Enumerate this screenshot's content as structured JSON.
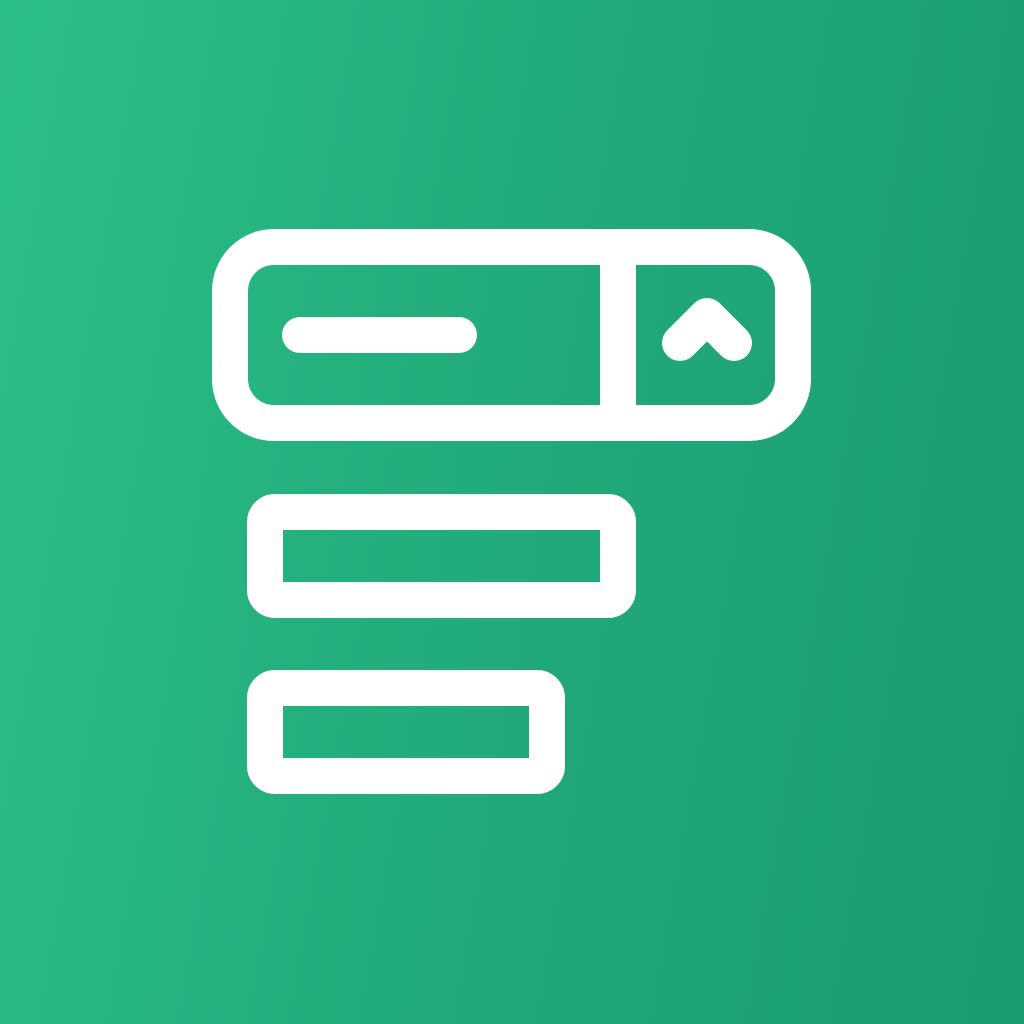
{
  "icon": {
    "name": "dropdown-select-icon",
    "background_start": "#2bbf88",
    "background_end": "#1a9c70",
    "stroke_color": "#ffffff",
    "parts": [
      "select-box-icon",
      "selected-value-line-icon",
      "chevron-up-icon",
      "option-item-icon",
      "option-item-icon"
    ]
  }
}
